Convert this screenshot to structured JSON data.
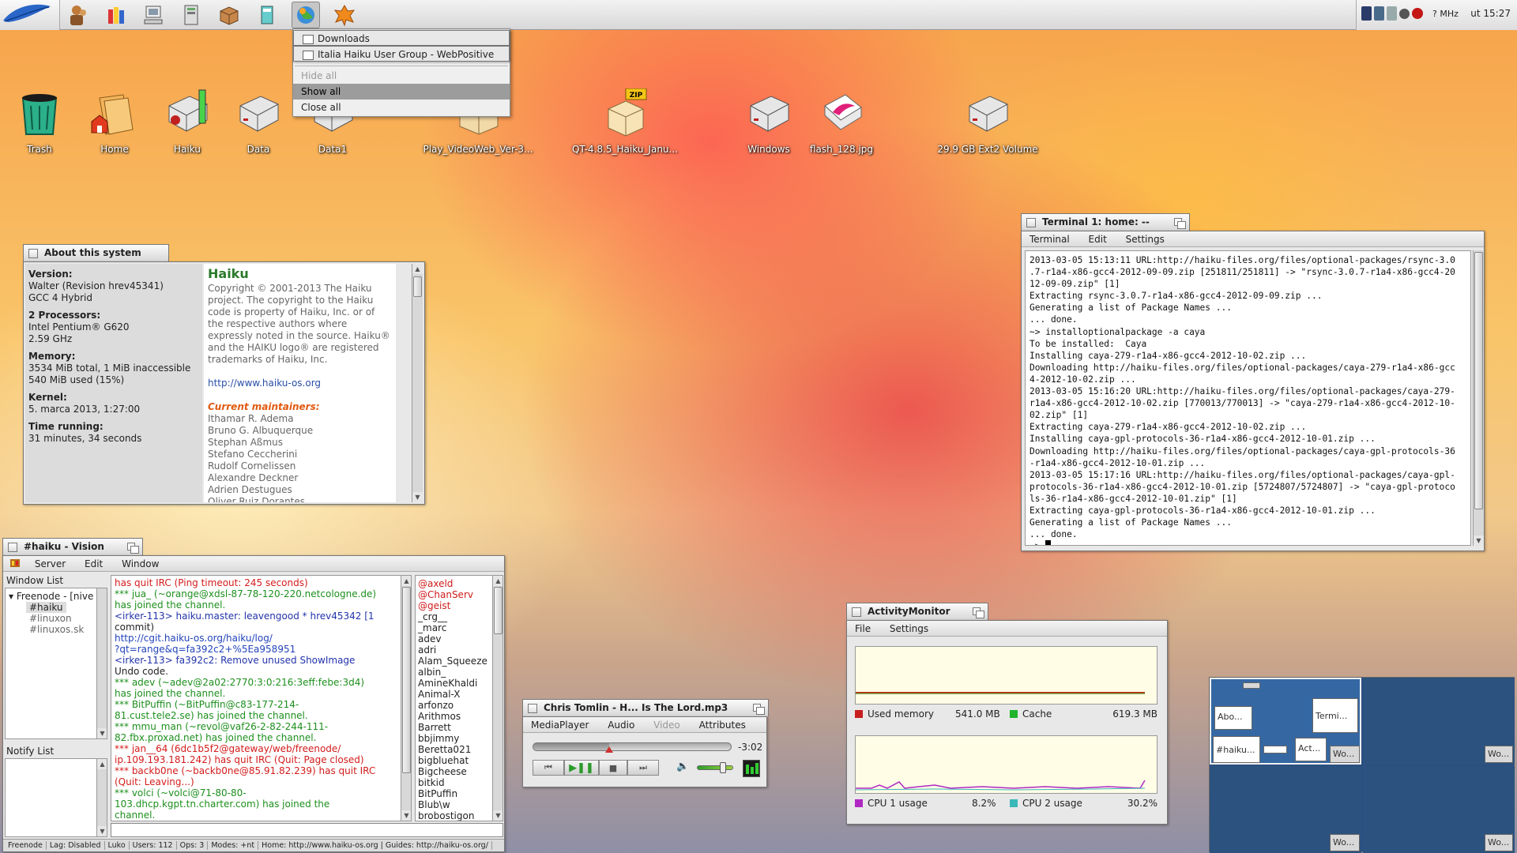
{
  "deskbar": {
    "tray_speed": "? MHz",
    "clock": "ut 15:27",
    "apps": [
      "leaf-menu",
      "app-1",
      "app-2",
      "app-3",
      "app-4",
      "app-5",
      "app-6",
      "app-7",
      "app-8"
    ]
  },
  "popup_menu": {
    "items": [
      {
        "label": "Downloads"
      },
      {
        "label": "Italia Haiku User Group - WebPositive"
      },
      {
        "label": "Hide all"
      },
      {
        "label": "Show all"
      },
      {
        "label": "Close all"
      }
    ]
  },
  "desktop_icons": [
    {
      "label": "Trash",
      "icon": "trash-icon"
    },
    {
      "label": "Home",
      "icon": "home-folder-icon"
    },
    {
      "label": "Haiku",
      "icon": "drive-icon"
    },
    {
      "label": "Data",
      "icon": "drive-icon"
    },
    {
      "label": "Data1",
      "icon": "drive-icon"
    },
    {
      "label": "Play_VideoWeb_Ver-3...",
      "icon": "package-icon"
    },
    {
      "label": "QT-4.8.5_Haiku_Janu...",
      "icon": "zip-package-icon"
    },
    {
      "label": "Windows",
      "icon": "drive-icon"
    },
    {
      "label": "flash_128.jpg",
      "icon": "image-file-icon"
    },
    {
      "label": "29.9 GB Ext2 Volume",
      "icon": "drive-icon"
    }
  ],
  "about_window": {
    "title": "About this system",
    "version_h": "Version:",
    "version_v1": "Walter (Revision hrev45341)",
    "version_v2": "GCC 4 Hybrid",
    "proc_h": "2 Processors:",
    "proc_v1": "Intel Pentium® G620",
    "proc_v2": "2.59 GHz",
    "mem_h": "Memory:",
    "mem_v1": "3534 MiB total, 1 MiB inaccessible",
    "mem_v2": "540 MiB used (15%)",
    "kernel_h": "Kernel:",
    "kernel_v": "5. marca 2013, 1:27:00",
    "time_h": "Time running:",
    "time_v": "31 minutes, 34 seconds",
    "haiku_title": "Haiku",
    "copyright": "Copyright © 2001-2013 The Haiku project. The copyright to the Haiku code is property of Haiku, Inc. or of the respective authors where expressly noted in the source. Haiku® and the HAIKU logo® are registered trademarks of Haiku, Inc.",
    "url": "http://www.haiku-os.org",
    "maint_h": "Current maintainers:",
    "maintainers": [
      "Ithamar R. Adema",
      "Bruno G. Albuquerque",
      "Stephan Aßmus",
      "Stefano Ceccherini",
      "Rudolf Cornelissen",
      "Alexandre Deckner",
      "Adrien Destugues",
      "Oliver Ruiz Dorantes"
    ]
  },
  "terminal": {
    "title": "Terminal 1: home: --",
    "menu": [
      "Terminal",
      "Edit",
      "Settings"
    ],
    "lines": [
      "2013-03-05 15:13:11 URL:http://haiku-files.org/files/optional-packages/rsync-3.0",
      ".7-r1a4-x86-gcc4-2012-09-09.zip [251811/251811] -> \"rsync-3.0.7-r1a4-x86-gcc4-20",
      "12-09-09.zip\" [1]",
      "Extracting rsync-3.0.7-r1a4-x86-gcc4-2012-09-09.zip ...",
      "Generating a list of Package Names ...",
      "... done.",
      "~> installoptionalpackage -a caya",
      "To be installed:  Caya",
      "Installing caya-279-r1a4-x86-gcc4-2012-10-02.zip ...",
      "Downloading http://haiku-files.org/files/optional-packages/caya-279-r1a4-x86-gcc",
      "4-2012-10-02.zip ...",
      "2013-03-05 15:16:20 URL:http://haiku-files.org/files/optional-packages/caya-279-",
      "r1a4-x86-gcc4-2012-10-02.zip [770013/770013] -> \"caya-279-r1a4-x86-gcc4-2012-10-",
      "02.zip\" [1]",
      "Extracting caya-279-r1a4-x86-gcc4-2012-10-02.zip ...",
      "Installing caya-gpl-protocols-36-r1a4-x86-gcc4-2012-10-01.zip ...",
      "Downloading http://haiku-files.org/files/optional-packages/caya-gpl-protocols-36",
      "-r1a4-x86-gcc4-2012-10-01.zip ...",
      "2013-03-05 15:17:16 URL:http://haiku-files.org/files/optional-packages/caya-gpl-",
      "protocols-36-r1a4-x86-gcc4-2012-10-01.zip [5724807/5724807] -> \"caya-gpl-protoco",
      "ls-36-r1a4-x86-gcc4-2012-10-01.zip\" [1]",
      "Extracting caya-gpl-protocols-36-r1a4-x86-gcc4-2012-10-01.zip ...",
      "Generating a list of Package Names ...",
      "... done."
    ],
    "prompt": "~> "
  },
  "vision": {
    "title": "#haiku - Vision",
    "menu": [
      "Server",
      "Edit",
      "Window"
    ],
    "window_list_label": "Window List",
    "tree": [
      "Freenode - [nive",
      "#haiku",
      "#linuxon",
      "#linuxos.sk"
    ],
    "notify_label": "Notify List",
    "messages": [
      {
        "c": "red",
        "t": "   has quit IRC (Ping timeout: 245 seconds)"
      },
      {
        "c": "green",
        "t": "*** jua_ (~orange@xdsl-87-78-120-220.netcologne.de)"
      },
      {
        "c": "green",
        "t": "   has joined the channel."
      },
      {
        "c": "blue",
        "t": "<irker-113> haiku.master: leavengood * hrev45342 [1"
      },
      {
        "c": "norm",
        "t": "   commit) "
      },
      {
        "c": "link",
        "t": "http://cgit.haiku-os.org/haiku/log/"
      },
      {
        "c": "link",
        "t": "   ?qt=range&q=fa392c2+%5Ea958951"
      },
      {
        "c": "blue",
        "t": "<irker-113>     fa392c2: Remove unused ShowImage"
      },
      {
        "c": "norm",
        "t": "   Undo code."
      },
      {
        "c": "green",
        "t": "*** adev (~adev@2a02:2770:3:0:216:3eff:febe:3d4)"
      },
      {
        "c": "green",
        "t": "   has joined the channel."
      },
      {
        "c": "green",
        "t": "*** BitPuffin (~BitPuffin@c83-177-214-"
      },
      {
        "c": "green",
        "t": "   81.cust.tele2.se) has joined the channel."
      },
      {
        "c": "green",
        "t": "*** mmu_man (~revol@vaf26-2-82-244-111-"
      },
      {
        "c": "green",
        "t": "   82.fbx.proxad.net) has joined the channel."
      },
      {
        "c": "red",
        "t": "*** jan__64 (6dc1b5f2@gateway/web/freenode/"
      },
      {
        "c": "red",
        "t": "   ip.109.193.181.242) has quit IRC (Quit: Page closed)"
      },
      {
        "c": "red",
        "t": "*** backb0ne (~backb0ne@85.91.82.239) has quit IRC"
      },
      {
        "c": "red",
        "t": "   (Quit: Leaving...)"
      },
      {
        "c": "green",
        "t": "*** volci (~volci@71-80-80-"
      },
      {
        "c": "green",
        "t": "   103.dhcp.kgpt.tn.charter.com) has joined the"
      },
      {
        "c": "green",
        "t": "   channel."
      }
    ],
    "users_ops": [
      "@axeld",
      "@ChanServ",
      "@geist"
    ],
    "users": [
      "_crg__",
      "_marc",
      "adev",
      "adri",
      "Alam_Squeeze",
      "albin_",
      "AmineKhaldi",
      "Animal-X",
      "arfonzo",
      "Arithmos",
      "Barrett",
      "bbjimmy",
      "Beretta021",
      "bigbluehat",
      "Bigcheese",
      "bitkid",
      "BitPuffin",
      "Blub\\w",
      "brobostigon"
    ],
    "status": [
      "Freenode",
      "Lag: Disabled",
      "Luko",
      "Users: 112",
      "Ops: 3",
      "Modes: +nt",
      "Home: http://www.haiku-os.org | Guides: http://haiku-os.org/"
    ]
  },
  "media_player": {
    "title": "Chris Tomlin - H... Is The Lord.mp3",
    "menu": [
      "MediaPlayer",
      "Audio",
      "Video",
      "Attributes"
    ],
    "time_remaining": "-3:02",
    "progress": 0.38,
    "volume": 0.7
  },
  "activity_monitor": {
    "title": "ActivityMonitor",
    "menu": [
      "File",
      "Settings"
    ],
    "used_memory_label": "Used memory",
    "used_memory_value": "541.0 MB",
    "cache_label": "Cache",
    "cache_value": "619.3 MB",
    "cpu1_label": "CPU 1 usage",
    "cpu1_value": "8.2%",
    "cpu2_label": "CPU 2 usage",
    "cpu2_value": "30.2%",
    "colors": {
      "memory": "#c81e1e",
      "cache": "#1fb42c",
      "cpu1": "#b028c4",
      "cpu2": "#3ab8b8"
    }
  },
  "workspaces": {
    "windows": [
      "Abo...",
      "Termi...",
      "#haiku...",
      "Act...",
      "Wo...",
      "Wo...",
      "Wo...",
      "Wo..."
    ]
  }
}
